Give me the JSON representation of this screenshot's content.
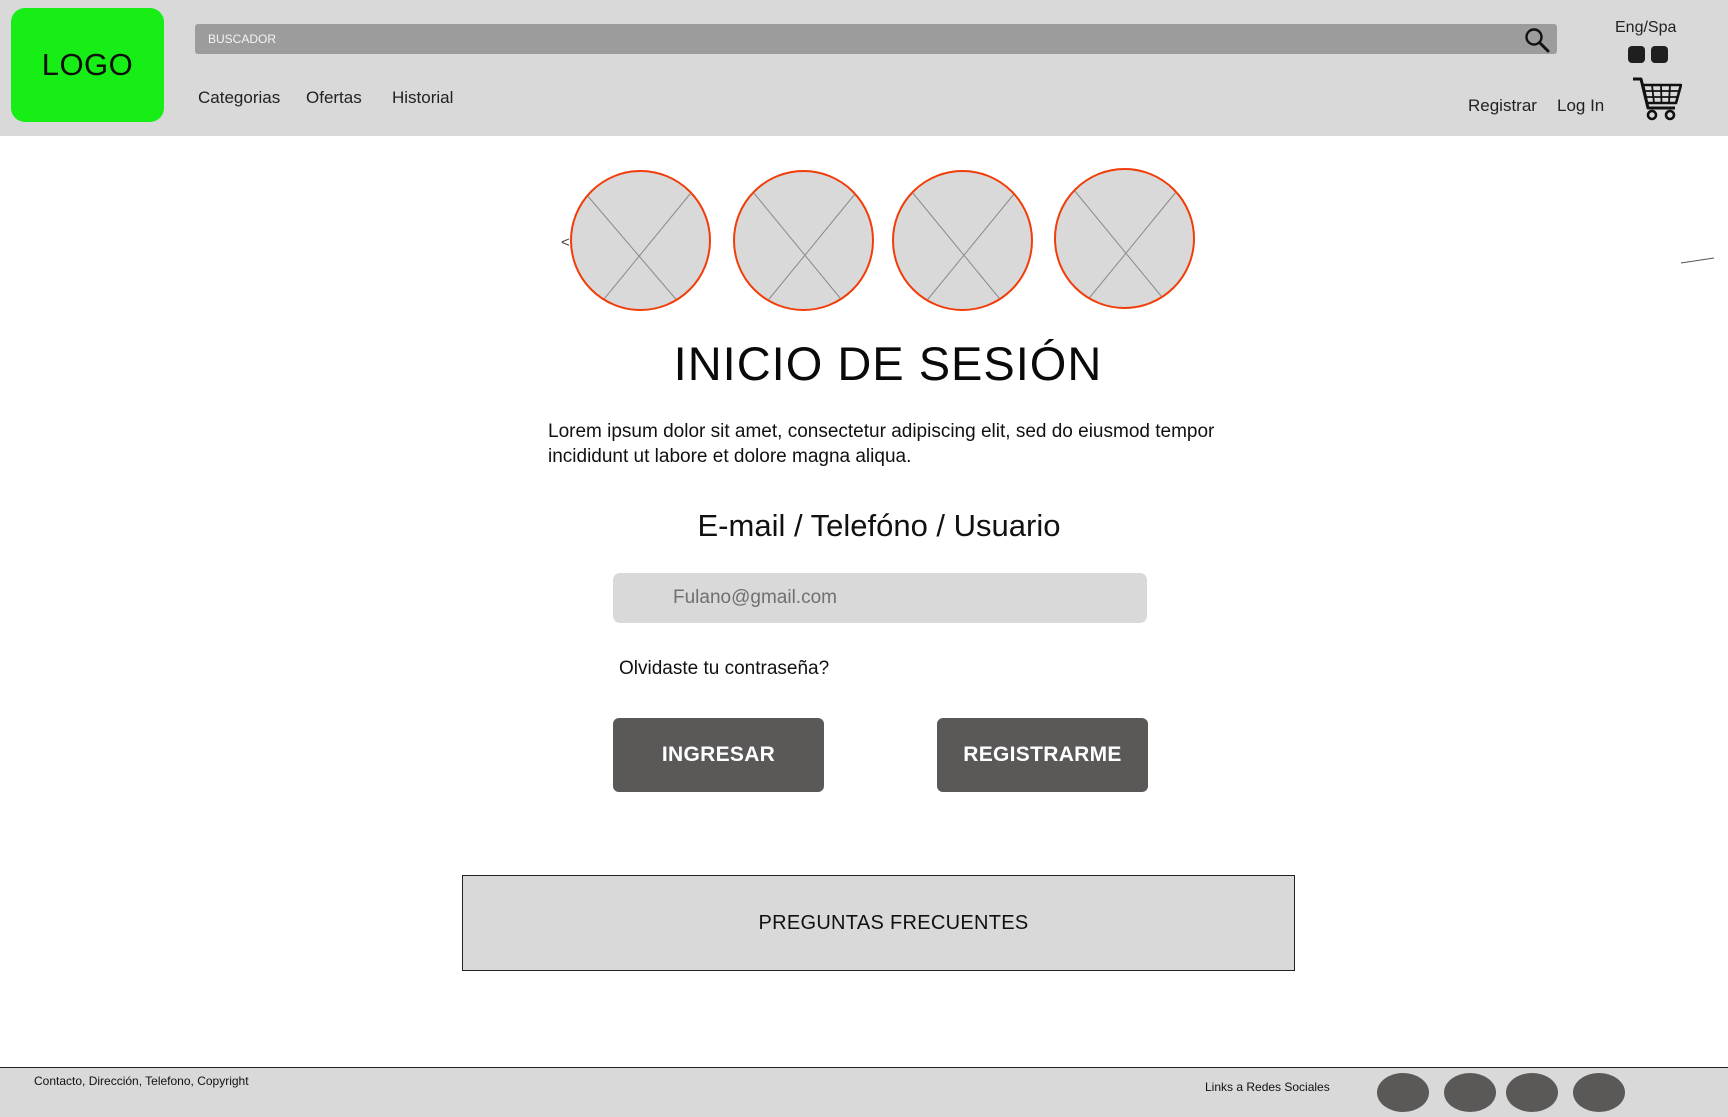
{
  "header": {
    "logo_text": "LOGO",
    "brand_color": "#16ee16",
    "search": {
      "placeholder": "BUSCADOR",
      "value": ""
    },
    "nav": [
      {
        "label": "Categorias"
      },
      {
        "label": "Ofertas"
      },
      {
        "label": "Historial"
      }
    ],
    "language_label": "Eng/Spa",
    "auth": {
      "register_label": "Registrar",
      "login_label": "Log In"
    },
    "icons": {
      "search": "search-icon",
      "cart": "shopping-cart-icon"
    }
  },
  "carousel": {
    "prev_label": "<",
    "items": [
      {
        "icon": "image-placeholder-icon"
      },
      {
        "icon": "image-placeholder-icon"
      },
      {
        "icon": "image-placeholder-icon"
      },
      {
        "icon": "image-placeholder-icon"
      }
    ],
    "border_color": "#f13d0a"
  },
  "main": {
    "title": "INICIO DE SESIÓN",
    "intro": "Lorem ipsum dolor sit amet, consectetur adipiscing elit, sed do eiusmod tempor incididunt ut labore et dolore magna aliqua.",
    "login_field": {
      "label": "E-mail / Telefóno / Usuario",
      "placeholder": "Fulano@gmail.com",
      "value": ""
    },
    "forgot_password": "Olvidaste tu contraseña?",
    "buttons": {
      "login": "INGRESAR",
      "register": "REGISTRARME"
    },
    "button_color": "#5b5858",
    "faq_label": "PREGUNTAS FRECUENTES"
  },
  "footer": {
    "info": "Contacto, Dirección, Telefono, Copyright",
    "social_label": "Links a Redes Sociales",
    "social_icons": [
      "social-icon-1",
      "social-icon-2",
      "social-icon-3",
      "social-icon-4"
    ]
  }
}
